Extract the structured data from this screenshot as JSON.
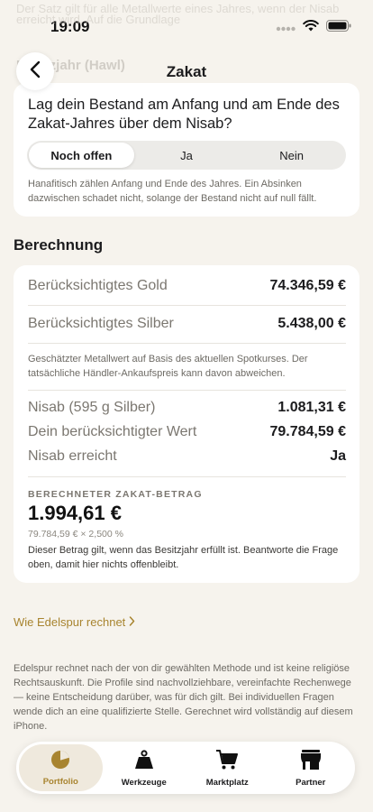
{
  "status": {
    "time": "19:09"
  },
  "background_hint": {
    "line1": "Der Satz gilt für alle Metallwerte eines Jahres, wenn der Nisab",
    "line2": "erreicht wird. Auf die Grundlage",
    "section_label": "Besitzjahr (Hawl)"
  },
  "nav": {
    "title": "Zakat"
  },
  "question": {
    "text": "Lag dein Bestand am Anfang und am Ende des Zakat-Jahres über dem Nisab?",
    "options": [
      "Noch offen",
      "Ja",
      "Nein"
    ],
    "selected": "Noch offen",
    "note": "Hanafitisch zählen Anfang und Ende des Jahres. Ein Absinken dazwischen schadet nicht, solange der Bestand nicht auf null fällt."
  },
  "calculation": {
    "title": "Berechnung",
    "gold": {
      "label": "Berücksichtigtes Gold",
      "value": "74.346,59 €"
    },
    "silver": {
      "label": "Berücksichtigtes Silber",
      "value": "5.438,00 €"
    },
    "metal_note": "Geschätzter Metallwert auf Basis des aktuellen Spotkurses. Der tatsächliche Händler-Ankaufspreis kann davon abweichen.",
    "nisab": {
      "label": "Nisab (595 g Silber)",
      "value": "1.081,31 €"
    },
    "considered": {
      "label": "Dein berücksichtigter Wert",
      "value": "79.784,59 €"
    },
    "reached": {
      "label": "Nisab erreicht",
      "value": "Ja"
    },
    "zakat_caption": "BERECHNETER ZAKAT-BETRAG",
    "zakat_amount": "1.994,61 €",
    "zakat_formula": "79.784,59 € × 2,500 %",
    "zakat_note": "Dieser Betrag gilt, wenn das Besitzjahr erfüllt ist. Beantworte die Frage oben, damit hier nichts offenbleibt."
  },
  "link": {
    "label": "Wie Edelspur rechnet"
  },
  "footer_note": "Edelspur rechnet nach der von dir gewählten Methode und ist keine religiöse Rechtsauskunft. Die Profile sind nachvollziehbare, vereinfachte Rechenwege — keine Entscheidung darüber, was für dich gilt. Bei individuellen Fragen wende dich an eine qualifizierte Stelle. Gerechnet wird vollständig auf diesem iPhone.",
  "tabs": [
    {
      "label": "Portfolio",
      "icon": "pie-chart-icon",
      "active": true
    },
    {
      "label": "Werkzeuge",
      "icon": "weight-icon",
      "active": false
    },
    {
      "label": "Marktplatz",
      "icon": "cart-icon",
      "active": false
    },
    {
      "label": "Partner",
      "icon": "store-icon",
      "active": false
    }
  ],
  "colors": {
    "accent": "#a8842f",
    "background": "#f6f3ed",
    "card": "#ffffff"
  }
}
